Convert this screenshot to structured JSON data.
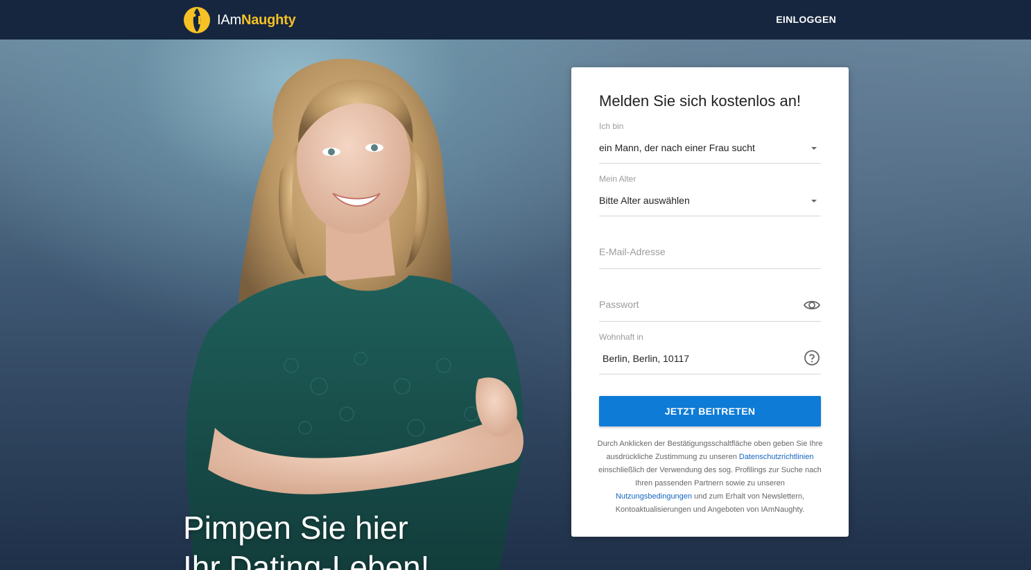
{
  "header": {
    "logo_text_plain": "IAm",
    "logo_text_accent": "Naughty",
    "login_label": "EINLOGGEN"
  },
  "hero": {
    "headline_line1": "Pimpen Sie hier",
    "headline_line2": "Ihr Dating-Leben!"
  },
  "form": {
    "title": "Melden Sie sich kostenlos an!",
    "i_am": {
      "label": "Ich bin",
      "value": "ein Mann, der nach einer Frau sucht"
    },
    "age": {
      "label": "Mein Alter",
      "value": "Bitte Alter auswählen"
    },
    "email": {
      "placeholder": "E-Mail-Adresse"
    },
    "password": {
      "placeholder": "Passwort",
      "icon": "eye-icon"
    },
    "location": {
      "label": "Wohnhaft in",
      "value": "Berlin, Berlin, 10117",
      "icon": "help-circle-icon"
    },
    "submit_label": "JETZT BEITRETEN",
    "legal": {
      "text_1": "Durch Anklicken der Bestätigungsschaltfläche oben geben Sie Ihre ausdrückliche Zustimmung zu unseren ",
      "privacy_link": "Datenschutzrichtlinien",
      "text_2": " einschließlich der Verwendung des sog. Profilings zur Suche nach Ihren passenden Partnern sowie zu unseren ",
      "terms_link": "Nutzungsbedingungen",
      "text_3": " und zum Erhalt von Newslettern, Kontoaktualisierungen und Angeboten von IAmNaughty."
    }
  },
  "colors": {
    "header_bg": "#16263f",
    "logo_accent": "#f5c125",
    "button_blue": "#0e7bd6",
    "link_blue": "#1565c0",
    "dress_teal": "#1d5a55"
  }
}
